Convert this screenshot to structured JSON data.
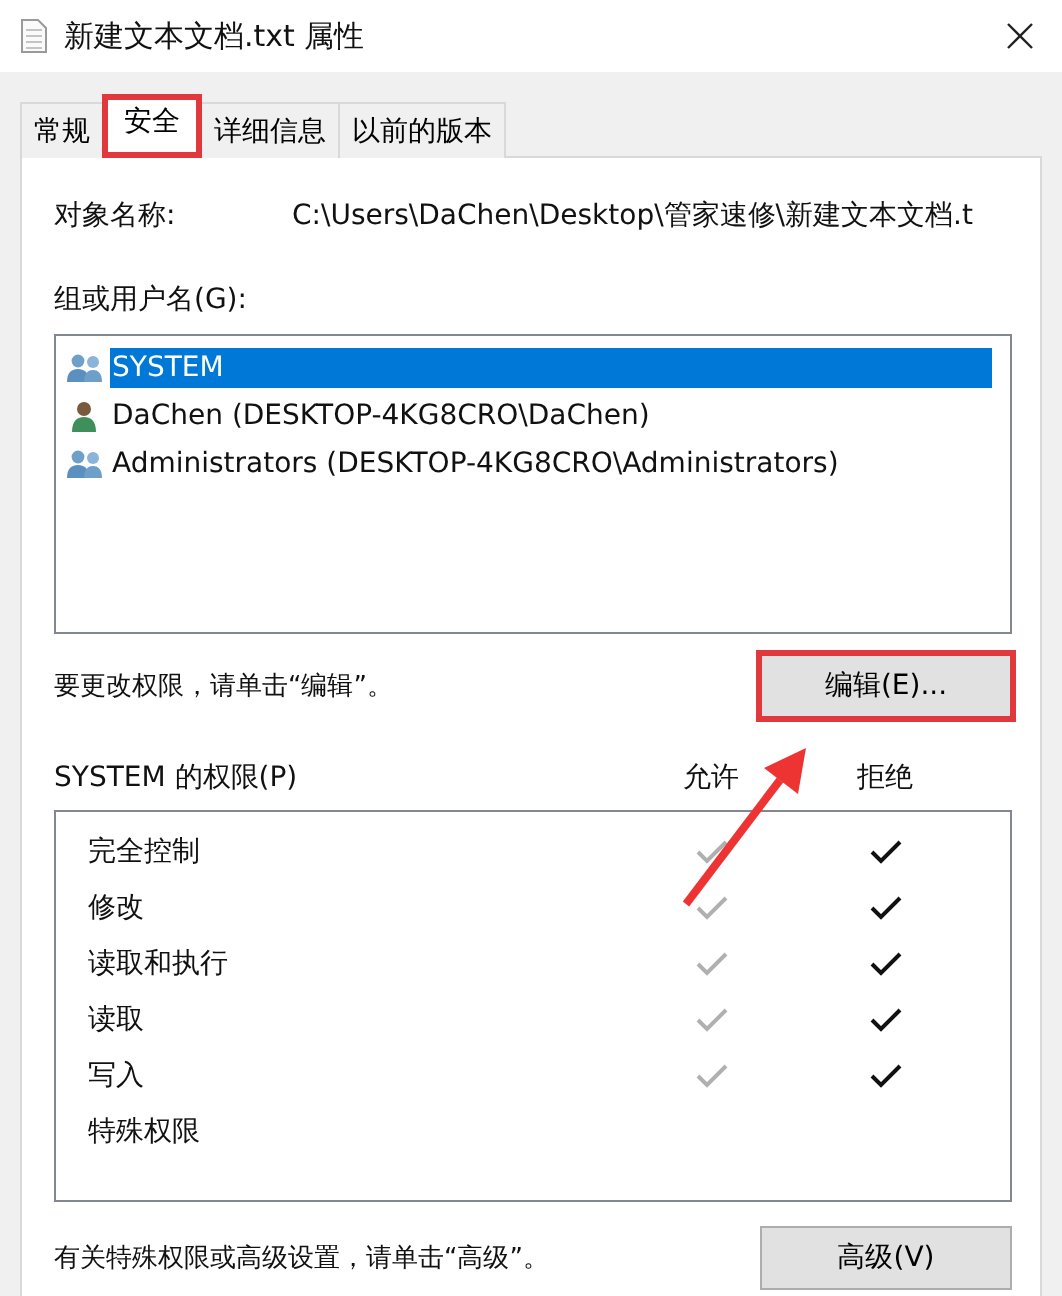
{
  "window": {
    "title": "新建文本文档.txt 属性"
  },
  "tabs": [
    {
      "label": "常规",
      "selected": false,
      "highlighted": false
    },
    {
      "label": "安全",
      "selected": true,
      "highlighted": true
    },
    {
      "label": "详细信息",
      "selected": false,
      "highlighted": false
    },
    {
      "label": "以前的版本",
      "selected": false,
      "highlighted": false
    }
  ],
  "object_name": {
    "label": "对象名称:",
    "value": "C:\\Users\\DaChen\\Desktop\\管家速修\\新建文本文档.t"
  },
  "groups": {
    "label": "组或用户名(G):",
    "items": [
      {
        "name": "SYSTEM",
        "kind": "group",
        "selected": true
      },
      {
        "name": "DaChen (DESKTOP-4KG8CRO\\DaChen)",
        "kind": "user",
        "selected": false
      },
      {
        "name": "Administrators (DESKTOP-4KG8CRO\\Administrators)",
        "kind": "group",
        "selected": false
      }
    ]
  },
  "edit": {
    "hint": "要更改权限，请单击“编辑”。",
    "button": "编辑(E)...",
    "highlighted": true
  },
  "permissions": {
    "label": "SYSTEM 的权限(P)",
    "columns": [
      {
        "label": "允许",
        "disabled": true
      },
      {
        "label": "拒绝",
        "disabled": false
      }
    ],
    "rows": [
      {
        "name": "完全控制",
        "allow": true,
        "deny": true
      },
      {
        "name": "修改",
        "allow": true,
        "deny": true
      },
      {
        "name": "读取和执行",
        "allow": true,
        "deny": true
      },
      {
        "name": "读取",
        "allow": true,
        "deny": true
      },
      {
        "name": "写入",
        "allow": true,
        "deny": true
      },
      {
        "name": "特殊权限",
        "allow": false,
        "deny": false
      }
    ]
  },
  "advanced": {
    "hint": "有关特殊权限或高级设置，请单击“高级”。",
    "button": "高级(V)",
    "highlighted": false
  }
}
